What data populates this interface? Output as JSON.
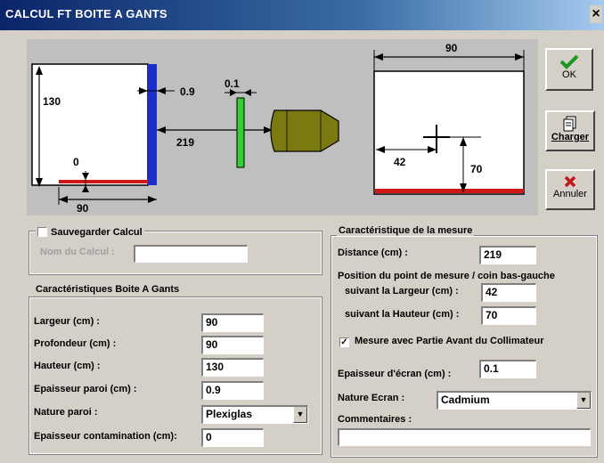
{
  "window": {
    "title": "CALCUL FT BOITE A GANTS",
    "close": "×"
  },
  "diagram": {
    "dim_top_width": "90",
    "dim_height": "130",
    "dim_wall": "0.9",
    "dim_screen": "0.1",
    "dim_distance": "219",
    "dim_contamination": "0",
    "dim_bottom_width": "90",
    "dim_pos_x": "42",
    "dim_pos_y": "70"
  },
  "buttons": {
    "ok": "OK",
    "charger": "Charger",
    "annuler": "Annuler"
  },
  "save": {
    "checkbox_label": "Sauvegarder Calcul",
    "name_label": "Nom du Calcul :",
    "name_value": ""
  },
  "box": {
    "group_title": "Caractéristiques Boite A Gants",
    "largeur_label": "Largeur  (cm) :",
    "largeur_value": "90",
    "profondeur_label": "Profondeur (cm) :",
    "profondeur_value": "90",
    "hauteur_label": "Hauteur (cm) :",
    "hauteur_value": "130",
    "paroi_label": "Epaisseur paroi (cm) :",
    "paroi_value": "0.9",
    "nature_label": "Nature paroi :",
    "nature_value": "Plexiglas",
    "contam_label": "Epaisseur contamination (cm):",
    "contam_value": "0"
  },
  "measure": {
    "group_title": "Caractéristique de la mesure",
    "distance_label": "Distance (cm) :",
    "distance_value": "219",
    "position_label": "Position du point de mesure / coin bas-gauche",
    "largeur_label": "suivant la Largeur (cm) :",
    "largeur_value": "42",
    "hauteur_label": "suivant la Hauteur (cm) :",
    "hauteur_value": "70",
    "collimator_label": "Mesure avec Partie Avant du Collimateur",
    "ecran_label": "Epaisseur d'écran (cm) :",
    "ecran_value": "0.1",
    "nature_label": "Nature Ecran :",
    "nature_value": "Cadmium",
    "comments_label": "Commentaires :",
    "comments_value": ""
  },
  "colors": {
    "wall": "#1f2ccc",
    "floor": "#d01818",
    "screen": "#2fd12f",
    "collimator": "#7a7a10"
  }
}
